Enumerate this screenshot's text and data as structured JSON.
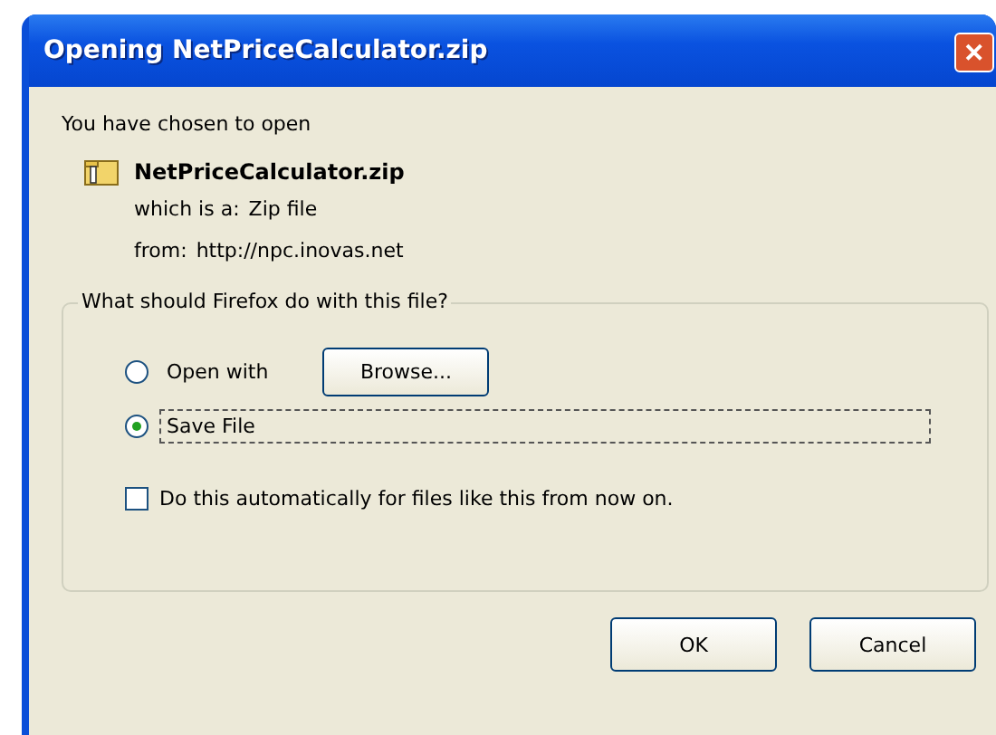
{
  "window": {
    "title": "Opening NetPriceCalculator.zip",
    "close": "✕"
  },
  "intro": "You have chosen to open",
  "file": {
    "name": "NetPriceCalculator.zip",
    "type_label": "which is a:",
    "type": "Zip file",
    "from_label": "from:",
    "from": "http://npc.inovas.net"
  },
  "action_group": {
    "legend": "What should Firefox do with this file?",
    "options": [
      {
        "label": "Open with",
        "selected": false,
        "focused": false,
        "button": "Browse..."
      },
      {
        "label": "Save File",
        "selected": true,
        "focused": true
      }
    ],
    "auto": {
      "label": "Do this automatically for files like this from now on.",
      "checked": false
    }
  },
  "buttons": [
    "OK",
    "Cancel"
  ]
}
